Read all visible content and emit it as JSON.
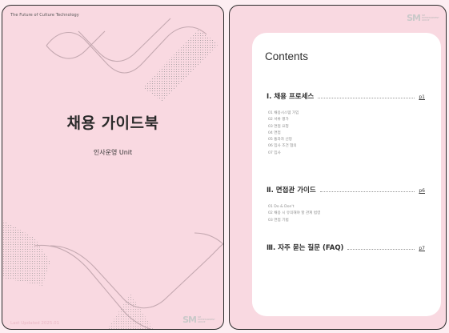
{
  "cover": {
    "tagline": "The Future of Culture Technology",
    "title": "채용 가이드북",
    "subtitle": "인사운영 Unit",
    "updated": "Last Updated 2025.01",
    "logo_mark": "SM",
    "logo_text": "SM ENTERTAINMENT GROUP"
  },
  "toc": {
    "title": "Contents",
    "logo_mark": "SM",
    "logo_text": "SM ENTERTAINMENT GROUP",
    "sections": [
      {
        "label": "Ⅰ. 채용 프로세스",
        "page": "p1",
        "items": [
          "01  채용시스템 가입",
          "02  서류 평가",
          "03  면접 요청",
          "04  면접",
          "05  통과자 선정",
          "06  입사 조건 협의",
          "07  입사"
        ]
      },
      {
        "label": "Ⅱ. 면접관 가이드",
        "page": "p6",
        "items": [
          "01  Do & Don't",
          "02  채용 시 유의해야 할 관계 법령",
          "03  면접 기법"
        ]
      },
      {
        "label": "Ⅲ. 자주 묻는 질문 (FAQ)",
        "page": "p7",
        "items": []
      }
    ]
  },
  "colors": {
    "background": "#fdeef2",
    "page": "#f9d9e1",
    "card": "#ffffff",
    "line": "#2b2b2b"
  }
}
